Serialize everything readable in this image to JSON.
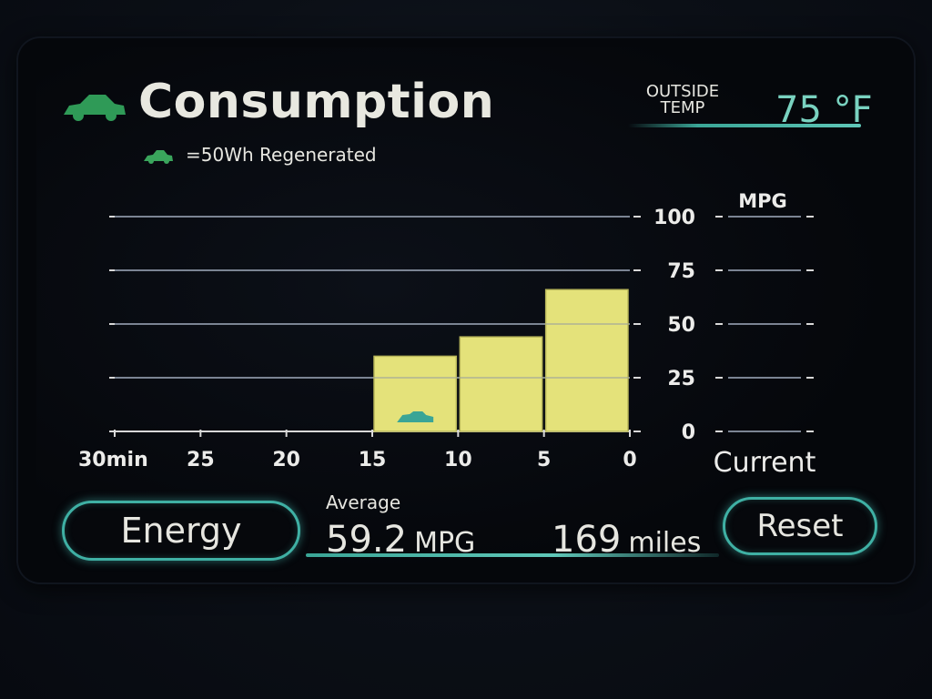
{
  "header": {
    "title": "Consumption",
    "icon": "car-icon",
    "regen_icon": "leaf-car-icon",
    "regen_note": "=50Wh Regenerated"
  },
  "outside_temp": {
    "label": "OUTSIDE\nTEMP",
    "value": "75 °F"
  },
  "chart_data": {
    "type": "bar",
    "categories": [
      "15–10",
      "10–5",
      "5–0"
    ],
    "values": [
      35,
      44,
      66
    ],
    "regen_icons": [
      1,
      0,
      0
    ],
    "ylabel": "MPG",
    "ylim": [
      0,
      100
    ],
    "y_ticks": [
      "0",
      "25",
      "50",
      "75",
      "100"
    ],
    "x_ticks": [
      "30min",
      "25",
      "20",
      "15",
      "10",
      "5",
      "0"
    ],
    "current_label": "Current",
    "grid": true,
    "colors": {
      "bar": "#e4e27a",
      "grid": "#7b8493",
      "regen_icon": "#3aa596"
    }
  },
  "footer": {
    "energy_button": "Energy",
    "average_label": "Average",
    "average_value": "59.2",
    "average_unit": "MPG",
    "distance_value": "169",
    "distance_unit": "miles",
    "reset_button": "Reset"
  },
  "colors": {
    "accent": "#3fb0a4",
    "text": "#e6e6e0",
    "temp": "#79d2c0",
    "icon_green": "#2f9a57"
  }
}
